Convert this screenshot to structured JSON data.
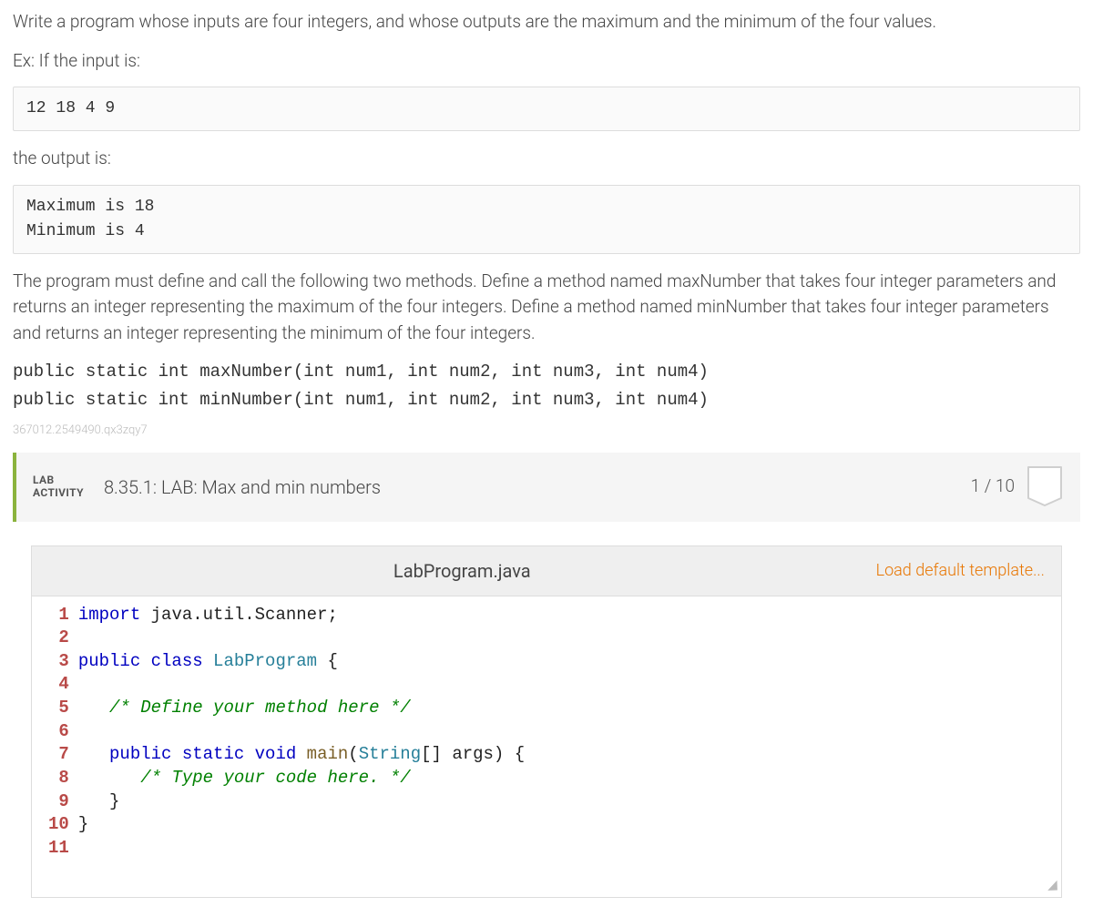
{
  "problem": {
    "intro": "Write a program whose inputs are four integers, and whose outputs are the maximum and the minimum of the four values.",
    "ex_label": "Ex: If the input is:",
    "ex_input": "12 18 4 9",
    "output_label": "the output is:",
    "ex_output": "Maximum is 18\nMinimum is 4",
    "requirement": "The program must define and call the following two methods. Define a method named maxNumber that takes four integer parameters and returns an integer representing the maximum of the four integers. Define a method named minNumber that takes four integer parameters and returns an integer representing the minimum of the four integers.",
    "sig1": "public static int maxNumber(int num1, int num2, int num3, int num4)",
    "sig2": "public static int minNumber(int num1, int num2, int num3, int num4)",
    "trace_id": "367012.2549490.qx3zqy7"
  },
  "lab": {
    "label_line1": "LAB",
    "label_line2": "ACTIVITY",
    "title": "8.35.1: LAB: Max and min numbers",
    "score": "1 / 10"
  },
  "editor": {
    "filename": "LabProgram.java",
    "load_template": "Load default template...",
    "line_count": 11,
    "code_lines": [
      {
        "n": 1,
        "segs": [
          {
            "c": "kw",
            "t": "import"
          },
          {
            "t": " java.util.Scanner;"
          }
        ]
      },
      {
        "n": 2,
        "segs": []
      },
      {
        "n": 3,
        "segs": [
          {
            "c": "kw",
            "t": "public class"
          },
          {
            "t": " "
          },
          {
            "c": "cls",
            "t": "LabProgram"
          },
          {
            "t": " {"
          }
        ]
      },
      {
        "n": 4,
        "segs": []
      },
      {
        "n": 5,
        "segs": [
          {
            "t": "   "
          },
          {
            "c": "cmt",
            "t": "/* Define your method here */"
          }
        ]
      },
      {
        "n": 6,
        "segs": []
      },
      {
        "n": 7,
        "segs": [
          {
            "t": "   "
          },
          {
            "c": "kw",
            "t": "public static void"
          },
          {
            "t": " "
          },
          {
            "c": "fn",
            "t": "main"
          },
          {
            "t": "("
          },
          {
            "c": "cls",
            "t": "String"
          },
          {
            "t": "[] args) {"
          }
        ]
      },
      {
        "n": 8,
        "segs": [
          {
            "t": "      "
          },
          {
            "c": "cmt",
            "t": "/* Type your code here. */"
          }
        ]
      },
      {
        "n": 9,
        "segs": [
          {
            "t": "   }"
          }
        ]
      },
      {
        "n": 10,
        "segs": [
          {
            "t": "}"
          }
        ]
      },
      {
        "n": 11,
        "segs": []
      }
    ]
  }
}
